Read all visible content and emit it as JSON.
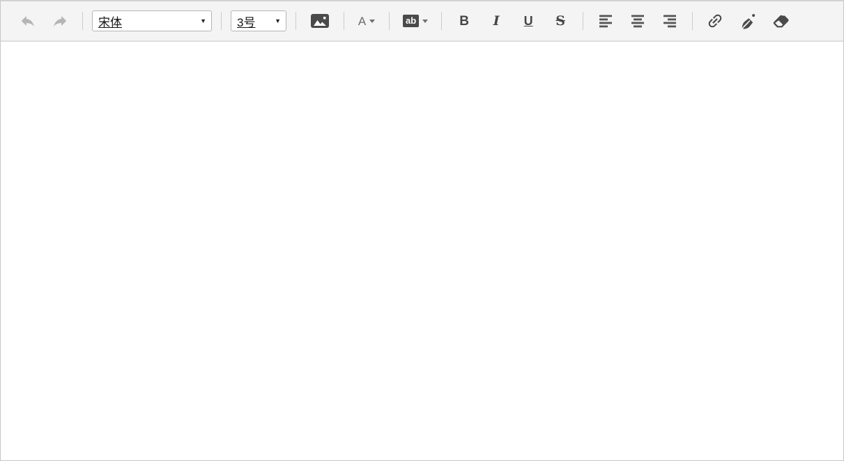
{
  "colors": {
    "toolbar_bg": "#f4f4f4",
    "frame_border": "#c6c6c6",
    "toolbar_bottom_border": "#d9dfe5",
    "separator": "#cccccc",
    "icon": "#4a4a4a",
    "icon_disabled": "#b5b5b5",
    "dark_badge_bg": "#4a4a4a",
    "select_border": "#b5b5b5",
    "content_bg": "#ffffff"
  },
  "toolbar": {
    "dropdown_arrow": "▼",
    "font_family_select": {
      "value": "宋体"
    },
    "font_size_select": {
      "value": "3号"
    },
    "font_color_label": "A",
    "highlight_label": "ab",
    "bold_label": "B",
    "italic_label": "I",
    "underline_label": "U",
    "strikethrough_label": "S",
    "icons": [
      "undo-icon",
      "redo-icon",
      "image-icon",
      "caret-down-icon",
      "align-left-icon",
      "align-center-icon",
      "align-right-icon",
      "link-icon",
      "brush-icon",
      "eraser-icon"
    ]
  },
  "editor": {
    "content": ""
  }
}
